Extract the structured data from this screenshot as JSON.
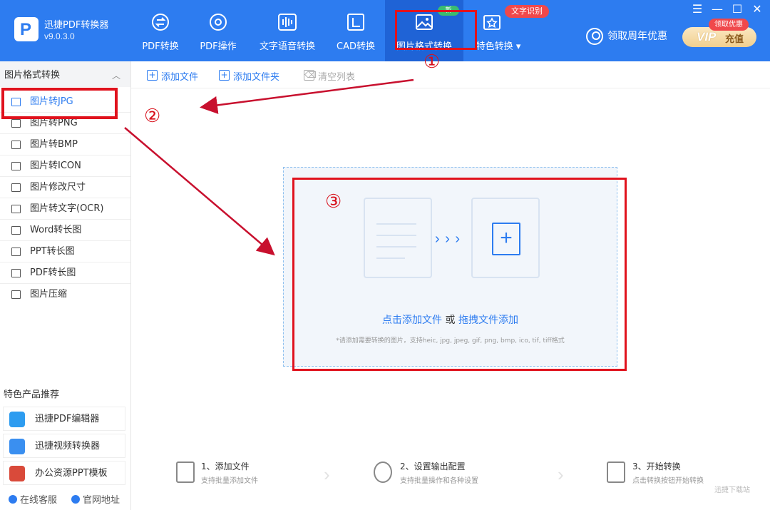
{
  "app": {
    "name": "迅捷PDF转换器",
    "version": "v9.0.3.0"
  },
  "nav": {
    "tabs": [
      {
        "label": "PDF转换",
        "icon": "convert-icon"
      },
      {
        "label": "PDF操作",
        "icon": "gear-icon"
      },
      {
        "label": "文字语音转换",
        "icon": "audio-wave-icon"
      },
      {
        "label": "CAD转换",
        "icon": "cad-icon"
      },
      {
        "label": "图片格式转换",
        "icon": "image-icon",
        "active": true
      },
      {
        "label": "特色转换",
        "icon": "star-convert-icon"
      }
    ],
    "badge_new": "新",
    "badge_ocr": "文字识别",
    "user_promo": "领取周年优惠",
    "vip_label": "VIP",
    "vip_action": "充值",
    "vip_badge": "领取优惠"
  },
  "window": {
    "menu": "☰",
    "minimize": "—",
    "maximize": "☐",
    "close": "✕"
  },
  "sidebar": {
    "section_title": "图片格式转换",
    "items": [
      {
        "label": "图片转JPG",
        "active": true
      },
      {
        "label": "图片转PNG"
      },
      {
        "label": "图片转BMP"
      },
      {
        "label": "图片转ICON"
      },
      {
        "label": "图片修改尺寸"
      },
      {
        "label": "图片转文字(OCR)"
      },
      {
        "label": "Word转长图"
      },
      {
        "label": "PPT转长图"
      },
      {
        "label": "PDF转长图"
      },
      {
        "label": "图片压缩"
      }
    ],
    "recommend_title": "特色产品推荐",
    "recommend": [
      {
        "label": "迅捷PDF编辑器",
        "color": "#2d9cf0"
      },
      {
        "label": "迅捷视频转换器",
        "color": "#3a8ff0"
      },
      {
        "label": "办公资源PPT模板",
        "color": "#d94a3a"
      }
    ],
    "footer": {
      "support": "在线客服",
      "website": "官网地址"
    }
  },
  "toolbar": {
    "add_file": "添加文件",
    "add_folder": "添加文件夹",
    "clear_list": "清空列表"
  },
  "dropzone": {
    "click_add": "点击添加文件",
    "or": "或",
    "drag_add": "拖拽文件添加",
    "hint": "*请添加需要转换的图片，支持heic, jpg, jpeg, gif, png, bmp, ico, tif, tiff格式"
  },
  "steps": [
    {
      "title": "1、添加文件",
      "desc": "支持批量添加文件"
    },
    {
      "title": "2、设置输出配置",
      "desc": "支持批量操作和各种设置"
    },
    {
      "title": "3、开始转换",
      "desc": "点击转换按钮开始转换"
    }
  ],
  "annotations": {
    "n1": "①",
    "n2": "②",
    "n3": "③"
  },
  "watermark": "迅捷下载站",
  "colors": {
    "primary": "#2d7cf0",
    "annotation": "#e0121d"
  }
}
